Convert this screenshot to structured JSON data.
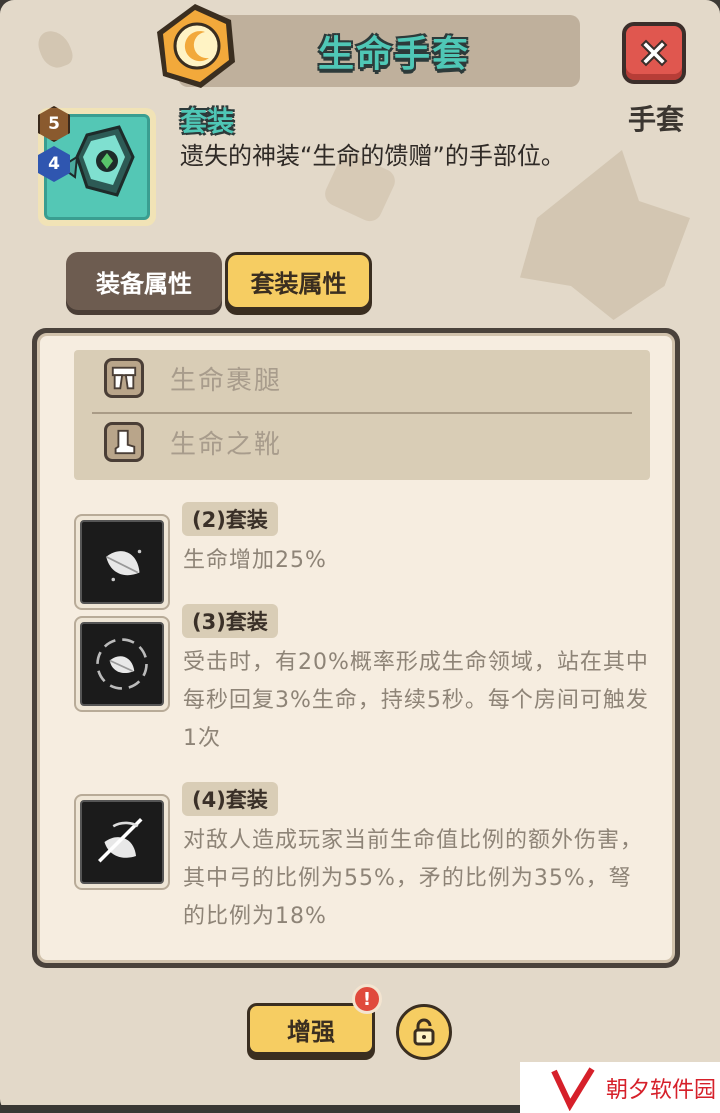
{
  "header": {
    "title": "生命手套",
    "slot_label": "手套",
    "close_icon": "close-x-icon",
    "badge_icon": "moon-badge-icon"
  },
  "item": {
    "set_tag": "套装",
    "description": "遗失的神装“生命的馈赠”的手部位。",
    "level_badges": [
      "5",
      "4"
    ],
    "icon": "gauntlet-icon"
  },
  "tabs": [
    {
      "label": "装备属性",
      "active": false
    },
    {
      "label": "套装属性",
      "active": true
    }
  ],
  "set_pieces": [
    {
      "name": "生命裹腿",
      "icon": "leggings-icon"
    },
    {
      "name": "生命之靴",
      "icon": "boots-icon"
    }
  ],
  "bonuses": [
    {
      "tag": "(2)套装",
      "text": "生命增加25%",
      "icon": "leaf-icon"
    },
    {
      "tag": "(3)套装",
      "text": "受击时，有20%概率形成生命领域，站在其中每秒回复3%生命，持续5秒。每个房间可触发1次",
      "icon": "leaf-swirl-icon"
    },
    {
      "tag": "(4)套装",
      "text": "对敌人造成玩家当前生命值比例的额外伤害，其中弓的比例为55%，矛的比例为35%，弩的比例为18%",
      "icon": "leaf-slash-icon"
    }
  ],
  "footer": {
    "enhance_label": "增强",
    "alert_mark": "!",
    "lock_icon": "unlock-icon"
  },
  "watermark": {
    "text": "朝夕软件园"
  },
  "colors": {
    "accent_teal": "#4fc7b6",
    "button_yellow": "#f6cd62",
    "close_red": "#e0574f"
  }
}
